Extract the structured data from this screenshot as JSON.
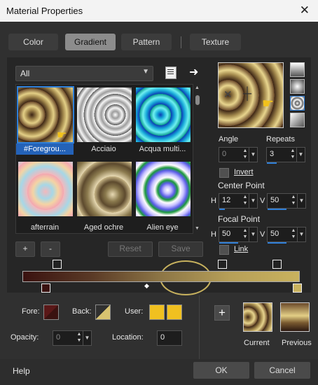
{
  "window": {
    "title": "Material Properties",
    "close_icon": "close-icon"
  },
  "tabs": [
    {
      "label": "Color"
    },
    {
      "label": "Gradient",
      "active": true
    },
    {
      "label": "Pattern"
    },
    {
      "label": "Texture"
    }
  ],
  "library": {
    "category": "All",
    "items": [
      {
        "label": "#Foregrou...",
        "selected": true
      },
      {
        "label": "Acciaio"
      },
      {
        "label": "Acqua multi..."
      },
      {
        "label": "afterrain"
      },
      {
        "label": "Aged ochre"
      },
      {
        "label": "Alien eye"
      }
    ]
  },
  "list_buttons": {
    "add": "+",
    "remove": "-",
    "reset": "Reset",
    "save": "Save"
  },
  "settings": {
    "angle_label": "Angle",
    "angle_value": "0",
    "repeats_label": "Repeats",
    "repeats_value": "3",
    "invert_label": "Invert",
    "center_point_label": "Center Point",
    "center_h_label": "H",
    "center_h": "12",
    "center_v_label": "V",
    "center_v": "50",
    "focal_point_label": "Focal Point",
    "focal_h_label": "H",
    "focal_h": "50",
    "focal_v_label": "V",
    "focal_v": "50",
    "link_label": "Link"
  },
  "colors": {
    "fore_label": "Fore:",
    "back_label": "Back:",
    "user_label": "User:",
    "user_color_1": "#f0c020",
    "user_color_2": "#f0c020",
    "accent": "#2f7fd8"
  },
  "opacity": {
    "label": "Opacity:",
    "value": "0"
  },
  "location": {
    "label": "Location:",
    "value": "0"
  },
  "preview": {
    "current_label": "Current",
    "previous_label": "Previous"
  },
  "footer": {
    "help": "Help",
    "ok": "OK",
    "cancel": "Cancel"
  }
}
